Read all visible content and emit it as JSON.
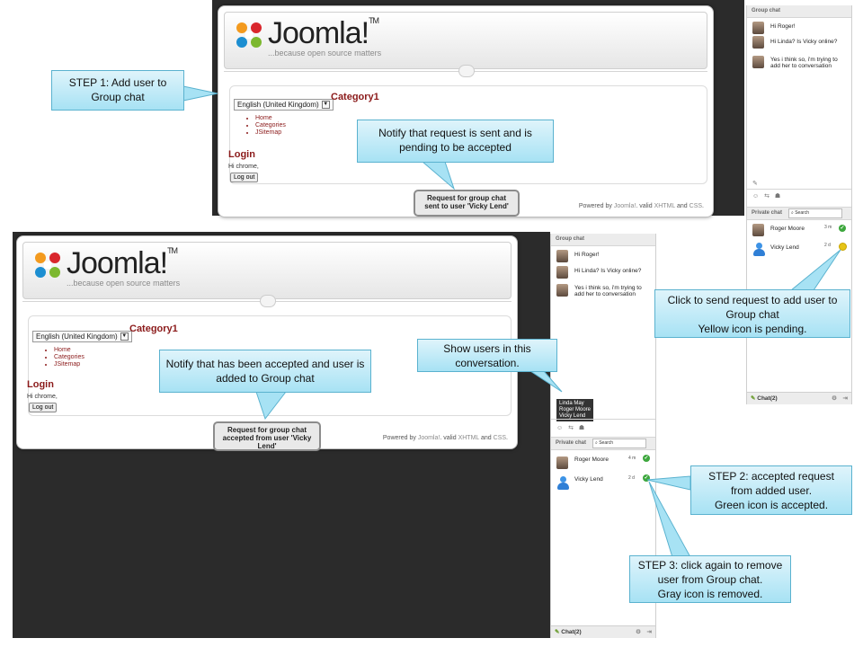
{
  "site": {
    "logo_text": "Joomla!",
    "tagline": "...because open source matters",
    "language": "English (United Kingdom)",
    "category": "Category1",
    "menu": [
      "Home",
      "Categories",
      "JSitemap"
    ],
    "login_heading": "Login",
    "greeting": "Hi chrome,",
    "logout_label": "Log out",
    "footer_prefix": "Powered by",
    "footer_link1": "Joomla!",
    "footer_mid": ". valid",
    "footer_link2": "XHTML",
    "footer_and": "and",
    "footer_link3": "CSS",
    "footer_dot": "."
  },
  "toasts": {
    "top": "Request for group chat sent to user 'Vicky Lend'",
    "bottom": "Request for group chat accepted from user 'Vicky Lend'"
  },
  "callouts": {
    "step1": "STEP 1: Add user to Group chat",
    "notify_pending": "Notify that request is sent and is pending to be accepted",
    "click_send": "Click to send request to add user to Group chat",
    "click_send_note": "Yellow icon is pending.",
    "notify_accepted": "Notify that has been accepted and user is added to Group chat",
    "show_users": "Show users in this conversation.",
    "step2": "STEP 2: accepted request from added user.",
    "step2_note": "Green icon is accepted.",
    "step3": "STEP 3: click again to remove user from Group chat.",
    "step3_note": "Gray icon is removed."
  },
  "chat": {
    "group_title": "Group chat",
    "messages": [
      "Hi Roger!",
      "Hi Linda? Is Vicky online?",
      "Yes i think so, i'm trying to add her to conversation"
    ],
    "private_title": "Private chat",
    "search_placeholder": "Search",
    "users_top": [
      {
        "name": "Roger Moore",
        "time": "3 m",
        "status": "accepted"
      },
      {
        "name": "Vicky Lend",
        "time": "2 d",
        "status": "pending"
      }
    ],
    "users_bottom": [
      {
        "name": "Roger Moore",
        "time": "4 m",
        "status": "accepted"
      },
      {
        "name": "Vicky Lend",
        "time": "2 d",
        "status": "accepted"
      }
    ],
    "participants": [
      "Linda May",
      "Roger Moore",
      "Vicky Lend"
    ],
    "footer_label": "Chat(2)",
    "accent_green": "#3da73d",
    "accent_yellow": "#e6c417",
    "callout_color": "#a7e2f4"
  }
}
